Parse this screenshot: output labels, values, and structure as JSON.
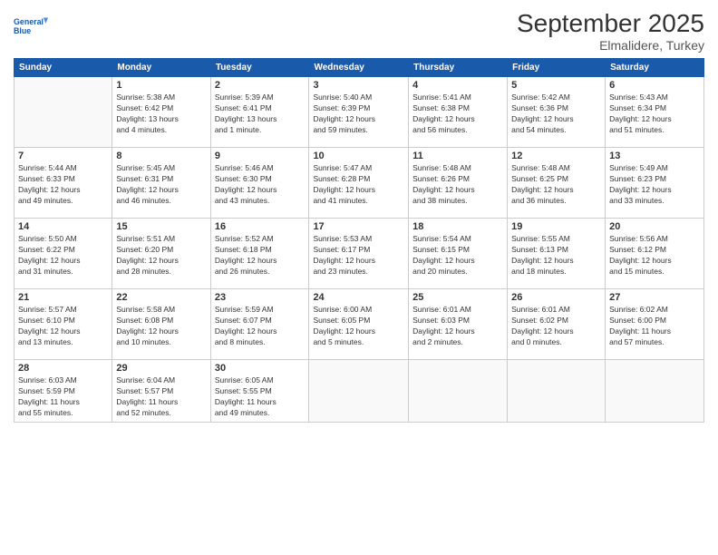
{
  "logo": {
    "line1": "General",
    "line2": "Blue"
  },
  "title": "September 2025",
  "subtitle": "Elmalidere, Turkey",
  "days_header": [
    "Sunday",
    "Monday",
    "Tuesday",
    "Wednesday",
    "Thursday",
    "Friday",
    "Saturday"
  ],
  "weeks": [
    [
      {
        "num": "",
        "info": ""
      },
      {
        "num": "1",
        "info": "Sunrise: 5:38 AM\nSunset: 6:42 PM\nDaylight: 13 hours\nand 4 minutes."
      },
      {
        "num": "2",
        "info": "Sunrise: 5:39 AM\nSunset: 6:41 PM\nDaylight: 13 hours\nand 1 minute."
      },
      {
        "num": "3",
        "info": "Sunrise: 5:40 AM\nSunset: 6:39 PM\nDaylight: 12 hours\nand 59 minutes."
      },
      {
        "num": "4",
        "info": "Sunrise: 5:41 AM\nSunset: 6:38 PM\nDaylight: 12 hours\nand 56 minutes."
      },
      {
        "num": "5",
        "info": "Sunrise: 5:42 AM\nSunset: 6:36 PM\nDaylight: 12 hours\nand 54 minutes."
      },
      {
        "num": "6",
        "info": "Sunrise: 5:43 AM\nSunset: 6:34 PM\nDaylight: 12 hours\nand 51 minutes."
      }
    ],
    [
      {
        "num": "7",
        "info": "Sunrise: 5:44 AM\nSunset: 6:33 PM\nDaylight: 12 hours\nand 49 minutes."
      },
      {
        "num": "8",
        "info": "Sunrise: 5:45 AM\nSunset: 6:31 PM\nDaylight: 12 hours\nand 46 minutes."
      },
      {
        "num": "9",
        "info": "Sunrise: 5:46 AM\nSunset: 6:30 PM\nDaylight: 12 hours\nand 43 minutes."
      },
      {
        "num": "10",
        "info": "Sunrise: 5:47 AM\nSunset: 6:28 PM\nDaylight: 12 hours\nand 41 minutes."
      },
      {
        "num": "11",
        "info": "Sunrise: 5:48 AM\nSunset: 6:26 PM\nDaylight: 12 hours\nand 38 minutes."
      },
      {
        "num": "12",
        "info": "Sunrise: 5:48 AM\nSunset: 6:25 PM\nDaylight: 12 hours\nand 36 minutes."
      },
      {
        "num": "13",
        "info": "Sunrise: 5:49 AM\nSunset: 6:23 PM\nDaylight: 12 hours\nand 33 minutes."
      }
    ],
    [
      {
        "num": "14",
        "info": "Sunrise: 5:50 AM\nSunset: 6:22 PM\nDaylight: 12 hours\nand 31 minutes."
      },
      {
        "num": "15",
        "info": "Sunrise: 5:51 AM\nSunset: 6:20 PM\nDaylight: 12 hours\nand 28 minutes."
      },
      {
        "num": "16",
        "info": "Sunrise: 5:52 AM\nSunset: 6:18 PM\nDaylight: 12 hours\nand 26 minutes."
      },
      {
        "num": "17",
        "info": "Sunrise: 5:53 AM\nSunset: 6:17 PM\nDaylight: 12 hours\nand 23 minutes."
      },
      {
        "num": "18",
        "info": "Sunrise: 5:54 AM\nSunset: 6:15 PM\nDaylight: 12 hours\nand 20 minutes."
      },
      {
        "num": "19",
        "info": "Sunrise: 5:55 AM\nSunset: 6:13 PM\nDaylight: 12 hours\nand 18 minutes."
      },
      {
        "num": "20",
        "info": "Sunrise: 5:56 AM\nSunset: 6:12 PM\nDaylight: 12 hours\nand 15 minutes."
      }
    ],
    [
      {
        "num": "21",
        "info": "Sunrise: 5:57 AM\nSunset: 6:10 PM\nDaylight: 12 hours\nand 13 minutes."
      },
      {
        "num": "22",
        "info": "Sunrise: 5:58 AM\nSunset: 6:08 PM\nDaylight: 12 hours\nand 10 minutes."
      },
      {
        "num": "23",
        "info": "Sunrise: 5:59 AM\nSunset: 6:07 PM\nDaylight: 12 hours\nand 8 minutes."
      },
      {
        "num": "24",
        "info": "Sunrise: 6:00 AM\nSunset: 6:05 PM\nDaylight: 12 hours\nand 5 minutes."
      },
      {
        "num": "25",
        "info": "Sunrise: 6:01 AM\nSunset: 6:03 PM\nDaylight: 12 hours\nand 2 minutes."
      },
      {
        "num": "26",
        "info": "Sunrise: 6:01 AM\nSunset: 6:02 PM\nDaylight: 12 hours\nand 0 minutes."
      },
      {
        "num": "27",
        "info": "Sunrise: 6:02 AM\nSunset: 6:00 PM\nDaylight: 11 hours\nand 57 minutes."
      }
    ],
    [
      {
        "num": "28",
        "info": "Sunrise: 6:03 AM\nSunset: 5:59 PM\nDaylight: 11 hours\nand 55 minutes."
      },
      {
        "num": "29",
        "info": "Sunrise: 6:04 AM\nSunset: 5:57 PM\nDaylight: 11 hours\nand 52 minutes."
      },
      {
        "num": "30",
        "info": "Sunrise: 6:05 AM\nSunset: 5:55 PM\nDaylight: 11 hours\nand 49 minutes."
      },
      {
        "num": "",
        "info": ""
      },
      {
        "num": "",
        "info": ""
      },
      {
        "num": "",
        "info": ""
      },
      {
        "num": "",
        "info": ""
      }
    ]
  ]
}
